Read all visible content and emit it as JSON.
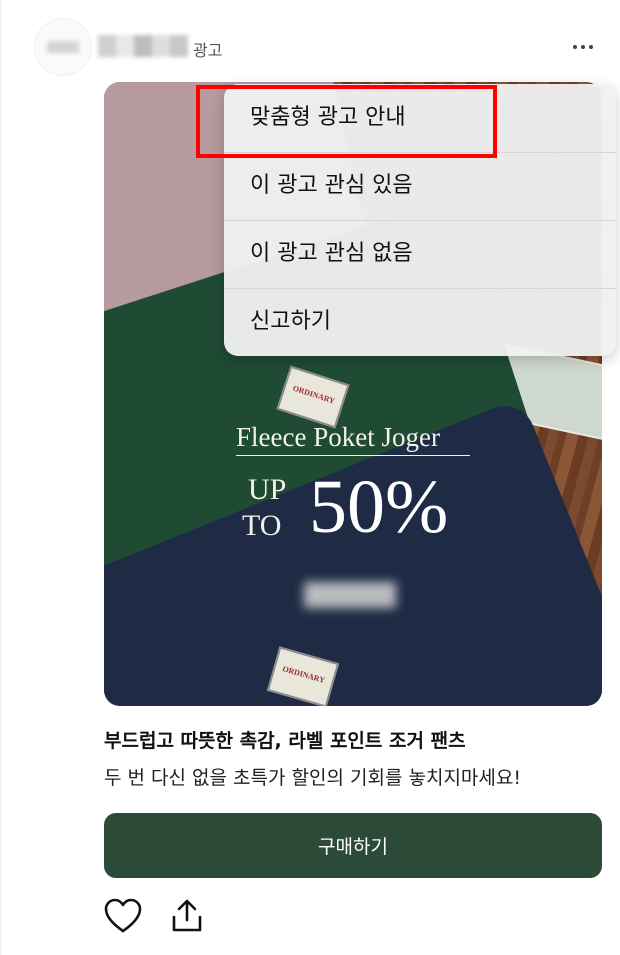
{
  "header": {
    "ad_badge": "광고"
  },
  "ad": {
    "headline": "Fleece Poket Joger",
    "promo_up": "UP",
    "promo_to": "TO",
    "promo_percent": "50%",
    "tag_text": "ORDINARY"
  },
  "menu": {
    "items": [
      {
        "label": "맞춤형 광고 안내"
      },
      {
        "label": "이 광고 관심 있음"
      },
      {
        "label": "이 광고 관심 없음"
      },
      {
        "label": "신고하기"
      }
    ],
    "highlight_color": "#ff0000"
  },
  "post": {
    "title": "부드럽고 따뜻한 촉감, 라벨 포인트 조거 팬츠",
    "description": "두 번 다신 없을 초특가 할인의 기회를 놓치지마세요!",
    "buy_button_label": "구매하기",
    "button_color": "#2c4a38"
  },
  "actions": {
    "icons": [
      "heart-icon",
      "share-icon"
    ]
  }
}
